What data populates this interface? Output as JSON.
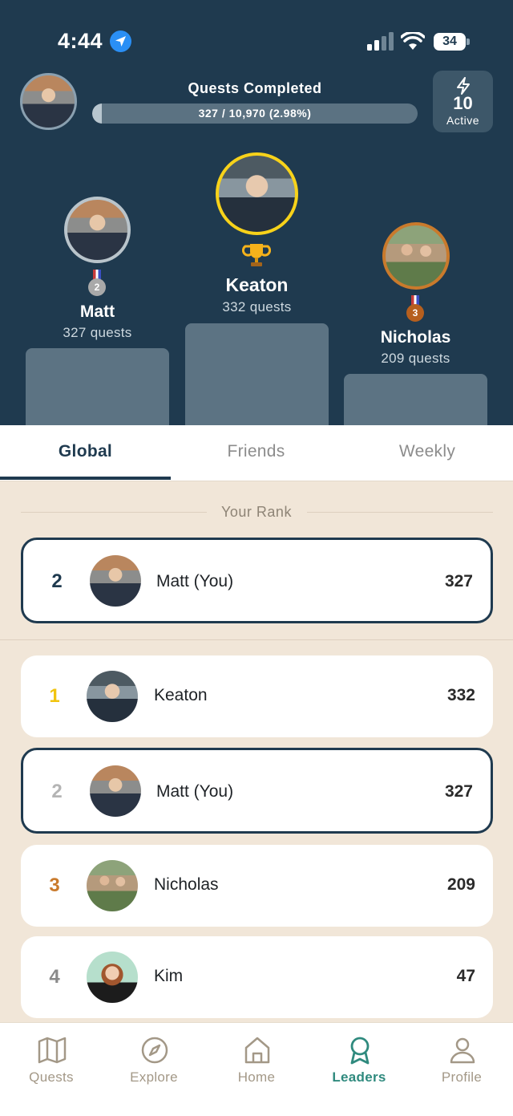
{
  "status_bar": {
    "time": "4:44",
    "battery": "34"
  },
  "header": {
    "quests_label": "Quests Completed",
    "progress_text": "327 / 10,970 (2.98%)",
    "progress_fraction": 0.0298,
    "active_count": "10",
    "active_label": "Active"
  },
  "podium": {
    "first": {
      "name": "Keaton",
      "quests": "332 quests"
    },
    "second": {
      "name": "Matt",
      "quests": "327 quests",
      "medal": "2"
    },
    "third": {
      "name": "Nicholas",
      "quests": "209 quests",
      "medal": "3"
    }
  },
  "tabs": [
    {
      "label": "Global"
    },
    {
      "label": "Friends"
    },
    {
      "label": "Weekly"
    }
  ],
  "your_rank": {
    "label": "Your Rank",
    "rank": "2",
    "name": "Matt (You)",
    "score": "327"
  },
  "leaderboard": [
    {
      "rank": "1",
      "name": "Keaton",
      "score": "332",
      "rank_color": "#f1c40f"
    },
    {
      "rank": "2",
      "name": "Matt (You)",
      "score": "327",
      "rank_color": "#b4b4b4"
    },
    {
      "rank": "3",
      "name": "Nicholas",
      "score": "209",
      "rank_color": "#c97a2c"
    },
    {
      "rank": "4",
      "name": "Kim",
      "score": "47",
      "rank_color": "#8a8a8a"
    }
  ],
  "nav": [
    {
      "label": "Quests",
      "icon": "map-icon"
    },
    {
      "label": "Explore",
      "icon": "compass-icon"
    },
    {
      "label": "Home",
      "icon": "home-icon"
    },
    {
      "label": "Leaders",
      "icon": "award-icon"
    },
    {
      "label": "Profile",
      "icon": "user-icon"
    }
  ],
  "colors": {
    "header_bg": "#1f3a4f",
    "accent": "#2f8a7e",
    "gold": "#f1c40f",
    "bronze": "#c97a2c"
  }
}
